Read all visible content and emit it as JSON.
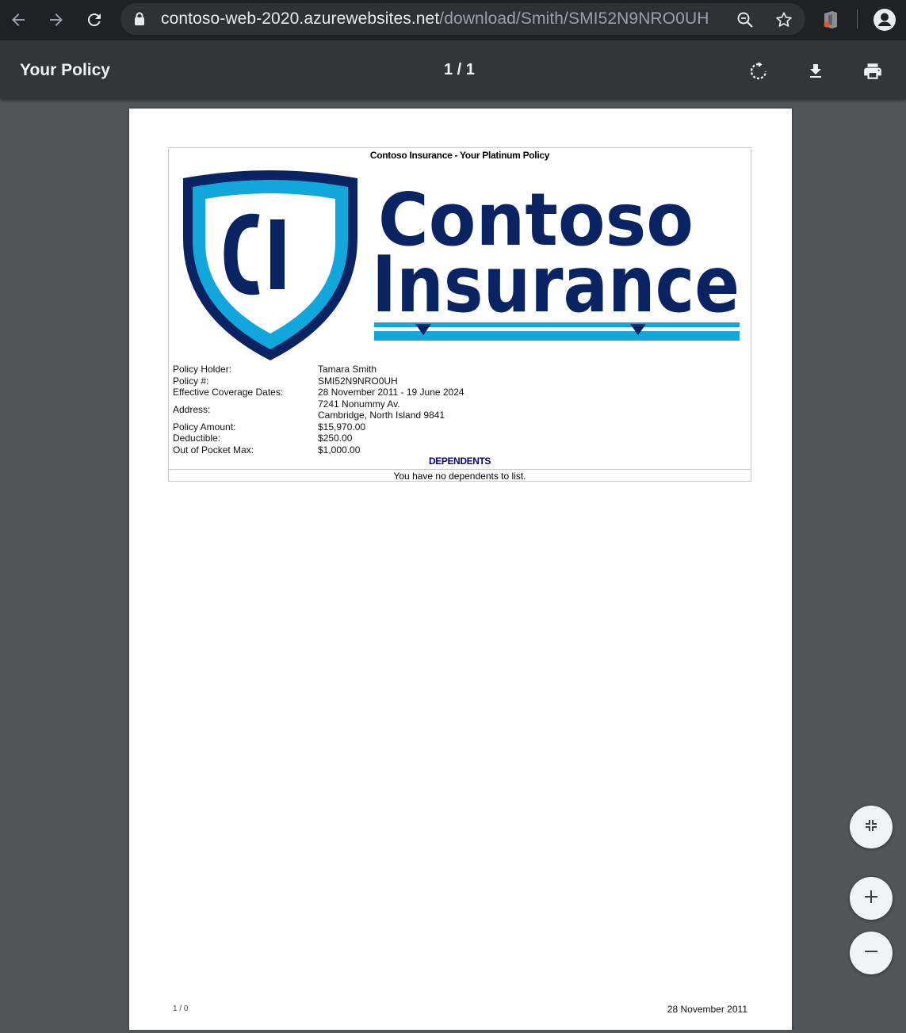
{
  "browser": {
    "url_host": "contoso-web-2020.azurewebsites.net",
    "url_path": "/download/Smith/SMI52N9NRO0UH",
    "icons": [
      "back-arrow-icon",
      "forward-arrow-icon",
      "reload-icon",
      "lock-icon",
      "zoom-icon",
      "star-icon",
      "office-extension-icon",
      "profile-icon"
    ]
  },
  "viewer": {
    "title": "Your Policy",
    "page_indicator": "1 / 1",
    "icons": [
      "rotate-icon",
      "download-icon",
      "print-icon",
      "fit-page-icon",
      "zoom-in-icon",
      "zoom-out-icon"
    ]
  },
  "document": {
    "header": "Contoso Insurance - Your Platinum Policy",
    "logo": {
      "monogram": "CI",
      "word1": "Contoso",
      "word2": "Insurance",
      "colors": {
        "navy": "#0a2463",
        "cyan": "#12a7dc"
      }
    },
    "fields": [
      {
        "label": "Policy Holder:",
        "value": "Tamara Smith"
      },
      {
        "label": "Policy #:",
        "value": "SMI52N9NRO0UH"
      },
      {
        "label": "Effective Coverage Dates:",
        "value": "28 November 2011 - 19 June 2024"
      }
    ],
    "address": {
      "label": "Address:",
      "line1": "7241 Nonummy Av.",
      "line2": "Cambridge, North Island 9841"
    },
    "amounts": [
      {
        "label": "Policy Amount:",
        "value": "$15,970.00"
      },
      {
        "label": "Deductible:",
        "value": "$250.00"
      },
      {
        "label": "Out of Pocket Max:",
        "value": "$1,000.00"
      }
    ],
    "dependents_title": "DEPENDENTS",
    "dependents_message": "You have no dependents to list.",
    "footer_left": "1 / 0",
    "footer_right": "28 November 2011"
  }
}
